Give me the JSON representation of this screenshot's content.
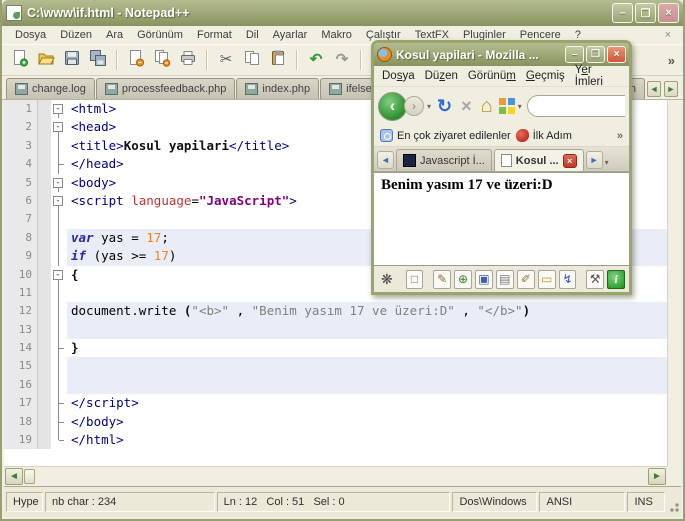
{
  "colors": {
    "titlebar-top": "#b5bd90",
    "titlebar-bottom": "#87935f",
    "chrome": "#f1efe2",
    "np-close": "#c98f8f",
    "ff-close": "#d4553b",
    "editor-hl": "#e9edf8",
    "tag": "#000080",
    "attr": "#c03434",
    "val": "#7f007f",
    "kw": "#2828a8",
    "num": "#ff8020",
    "str": "#808080"
  },
  "notepadpp": {
    "title": "C:\\www\\if.html - Notepad++",
    "window_buttons": {
      "minimize": "–",
      "maximize": "❐",
      "close": "×"
    },
    "menus": [
      "Dosya",
      "Düzen",
      "Ara",
      "Görünüm",
      "Format",
      "Dil",
      "Ayarlar",
      "Makro",
      "Çalıştır",
      "TextFX",
      "Pluginler",
      "Pencere",
      "?"
    ],
    "menu_close_glyph": "×",
    "toolbar": [
      "new",
      "open",
      "save",
      "save-all",
      "sep",
      "close",
      "close-all",
      "print",
      "sep",
      "cut",
      "copy",
      "paste",
      "sep",
      "undo",
      "redo",
      "sep",
      "find",
      "replace"
    ],
    "toolbar_overflow": "»",
    "tabs": [
      "change.log",
      "processfeedback.php",
      "index.php",
      "ifelse.php"
    ],
    "partial_tab": "x.ph",
    "editor_lines": [
      {
        "n": 1,
        "fold": "box",
        "hl": false,
        "toks": [
          [
            "tag",
            "<html>"
          ]
        ]
      },
      {
        "n": 2,
        "fold": "box",
        "hl": false,
        "toks": [
          [
            "tag",
            "<head>"
          ]
        ]
      },
      {
        "n": 3,
        "fold": "line",
        "hl": false,
        "toks": [
          [
            "tag",
            "<title>"
          ],
          [
            "b",
            "Kosul yapilari"
          ],
          [
            "tag",
            "</title>"
          ]
        ]
      },
      {
        "n": 4,
        "fold": "tick",
        "hl": false,
        "toks": [
          [
            "tag",
            "</head>"
          ]
        ]
      },
      {
        "n": 5,
        "fold": "box",
        "hl": false,
        "toks": [
          [
            "tag",
            "<body>"
          ]
        ]
      },
      {
        "n": 6,
        "fold": "box",
        "hl": false,
        "toks": [
          [
            "tag",
            "<script "
          ],
          [
            "attr",
            "language"
          ],
          [
            "plain",
            "="
          ],
          [
            "val",
            "\"JavaScript\""
          ],
          [
            "tag",
            ">"
          ]
        ]
      },
      {
        "n": 7,
        "fold": "line",
        "hl": false,
        "toks": []
      },
      {
        "n": 8,
        "fold": "line",
        "hl": true,
        "toks": [
          [
            "kw",
            "var"
          ],
          [
            "plain",
            " yas = "
          ],
          [
            "num",
            "17"
          ],
          [
            "plain",
            ";"
          ]
        ]
      },
      {
        "n": 9,
        "fold": "line",
        "hl": true,
        "toks": [
          [
            "kw",
            "if"
          ],
          [
            "plain",
            " (yas >= "
          ],
          [
            "num",
            "17"
          ],
          [
            "plain",
            ")"
          ]
        ]
      },
      {
        "n": 10,
        "fold": "box",
        "hl": false,
        "toks": [
          [
            "b",
            "{"
          ]
        ]
      },
      {
        "n": 11,
        "fold": "line",
        "hl": false,
        "toks": []
      },
      {
        "n": 12,
        "fold": "line",
        "hl": true,
        "toks": [
          [
            "plain",
            "document.write "
          ],
          [
            "b",
            "("
          ],
          [
            "str",
            "\"<b>\""
          ],
          [
            "plain",
            " , "
          ],
          [
            "str",
            "\"Benim yasım 17 ve üzeri:D\""
          ],
          [
            "plain",
            " , "
          ],
          [
            "str",
            "\"</b>\""
          ],
          [
            "b",
            ")"
          ]
        ]
      },
      {
        "n": 13,
        "fold": "line",
        "hl": true,
        "toks": []
      },
      {
        "n": 14,
        "fold": "tick",
        "hl": false,
        "toks": [
          [
            "b",
            "}"
          ]
        ]
      },
      {
        "n": 15,
        "fold": "line",
        "hl": true,
        "toks": []
      },
      {
        "n": 16,
        "fold": "line",
        "hl": true,
        "toks": []
      },
      {
        "n": 17,
        "fold": "tick",
        "hl": false,
        "toks": [
          [
            "tag",
            "</script>"
          ]
        ]
      },
      {
        "n": 18,
        "fold": "tick",
        "hl": false,
        "toks": [
          [
            "tag",
            "</body>"
          ]
        ]
      },
      {
        "n": 19,
        "fold": "end",
        "hl": false,
        "toks": [
          [
            "tag",
            "</html>"
          ]
        ]
      }
    ],
    "statusbar": {
      "doctype": "Hype",
      "chars": "nb char : 234",
      "caret": "Ln : 12   Col : 51   Sel : 0",
      "eol": "Dos\\Windows",
      "encoding": "ANSI",
      "insert": "INS"
    }
  },
  "firefox": {
    "title": "Kosul yapilari - Mozilla ...",
    "window_buttons": {
      "minimize": "–",
      "maximize": "❐",
      "close": "×"
    },
    "menus": [
      {
        "pre": "Do",
        "key": "s",
        "post": "ya"
      },
      {
        "pre": "Dü",
        "key": "z",
        "post": "en"
      },
      {
        "pre": "Görünü",
        "key": "m",
        "post": ""
      },
      {
        "pre": "",
        "key": "G",
        "post": "eçmiş"
      },
      {
        "pre": "Y",
        "key": "e",
        "post": "r İmleri"
      }
    ],
    "nav_glyphs": {
      "back": "‹",
      "forward": "›",
      "dropdown": "▾",
      "refresh": "↻",
      "stop": "×",
      "home": "⌂"
    },
    "bookmarks": [
      {
        "icon": "most-visited",
        "label": "En çok ziyaret edilenler"
      },
      {
        "icon": "feed",
        "label": "İlk Adım"
      }
    ],
    "bookmarks_overflow": "»",
    "tab_scroll": {
      "left": "◄",
      "right": "►",
      "dropdown": "▾"
    },
    "tabs": [
      {
        "label": "Javascript İ...",
        "active": false,
        "favicon": "dark",
        "closable": false
      },
      {
        "label": "Kosul ...",
        "active": true,
        "favicon": "page",
        "closable": true,
        "close_glyph": "×"
      }
    ],
    "content": "Benim yasım 17 ve üzeri:D",
    "status_icons": [
      "bug",
      "new-page",
      "pencil",
      "globe",
      "save",
      "print",
      "edit-note",
      "form",
      "lightning",
      "tools",
      "info"
    ]
  }
}
